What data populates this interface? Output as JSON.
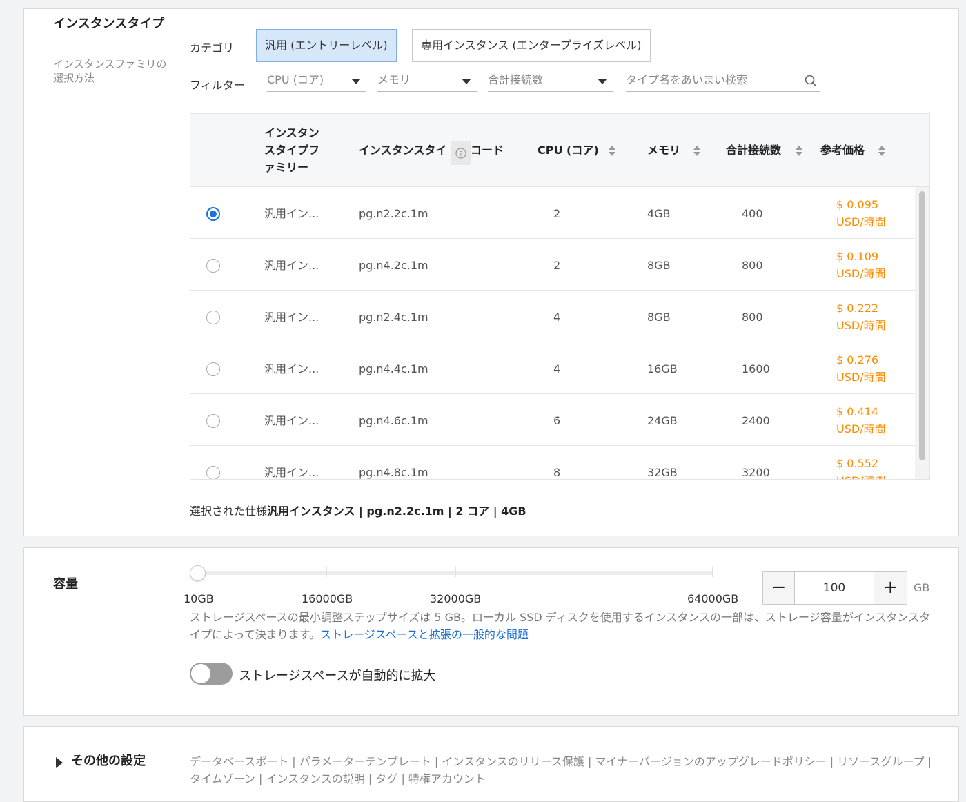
{
  "instance_section": {
    "title": "インスタンスタイプ",
    "subtitle": "インスタンスファミリの選択方法",
    "category_label": "カテゴリ",
    "categories": [
      "汎用 (エントリーレベル)",
      "専用インスタンス (エンタープライズレベル)"
    ],
    "selected_category": "汎用 (エントリーレベル)",
    "filter_label": "フィルター",
    "filters": {
      "cpu_placeholder": "CPU (コア)",
      "memory_placeholder": "メモリ",
      "connections_placeholder": "合計接続数",
      "search_placeholder": "タイプ名をあいまい検索"
    },
    "table": {
      "headers": {
        "family": "インスタンスタイプファミリー",
        "code": "インスタンスタイ",
        "code_tail": "コード",
        "cpu": "CPU (コア)",
        "memory": "メモリ",
        "connections": "合計接続数",
        "price": "参考価格"
      },
      "rows": [
        {
          "family": "汎用イン...",
          "code": "pg.n2.2c.1m",
          "cpu": "2",
          "memory": "4GB",
          "connections": "400",
          "price": "$ 0.095",
          "unit": "USD/時間"
        },
        {
          "family": "汎用イン...",
          "code": "pg.n4.2c.1m",
          "cpu": "2",
          "memory": "8GB",
          "connections": "800",
          "price": "$ 0.109",
          "unit": "USD/時間"
        },
        {
          "family": "汎用イン...",
          "code": "pg.n2.4c.1m",
          "cpu": "4",
          "memory": "8GB",
          "connections": "800",
          "price": "$ 0.222",
          "unit": "USD/時間"
        },
        {
          "family": "汎用イン...",
          "code": "pg.n4.4c.1m",
          "cpu": "4",
          "memory": "16GB",
          "connections": "1600",
          "price": "$ 0.276",
          "unit": "USD/時間"
        },
        {
          "family": "汎用イン...",
          "code": "pg.n4.6c.1m",
          "cpu": "6",
          "memory": "24GB",
          "connections": "2400",
          "price": "$ 0.414",
          "unit": "USD/時間"
        },
        {
          "family": "汎用イン...",
          "code": "pg.n4.8c.1m",
          "cpu": "8",
          "memory": "32GB",
          "connections": "3200",
          "price": "$ 0.552",
          "unit": "USD/時間"
        }
      ],
      "selected_row": 0
    },
    "selected_spec_label": "選択された仕様",
    "selected_spec_value": "汎用インスタンス | pg.n2.2c.1m | 2 コア | 4GB"
  },
  "capacity_section": {
    "title": "容量",
    "slider_labels": [
      "10GB",
      "16000GB",
      "32000GB",
      "64000GB"
    ],
    "value": "100",
    "unit": "GB",
    "minus_label": "−",
    "plus_label": "+",
    "note": "ストレージスペースの最小調整ステップサイズは 5 GB。ローカル SSD ディスクを使用するインスタンスの一部は、ストレージ容量がインスタンスタイプによって決まります。",
    "note_link": "ストレージスペースと拡張の一般的な問題",
    "auto_expand_label": "ストレージスペースが自動的に拡大",
    "auto_expand_enabled": false
  },
  "other_section": {
    "title": "その他の設定",
    "items": "データベースポート | パラメーターテンプレート | インスタンスのリリース保護 | マイナーバージョンのアップグレードポリシー | リソースグループ | タイムゾーン | インスタンスの説明 | タグ | 特権アカウント"
  },
  "colors": {
    "accent": "#1a73d9",
    "price": "#ff8a00",
    "active_category_bg": "#d6e7f9"
  }
}
